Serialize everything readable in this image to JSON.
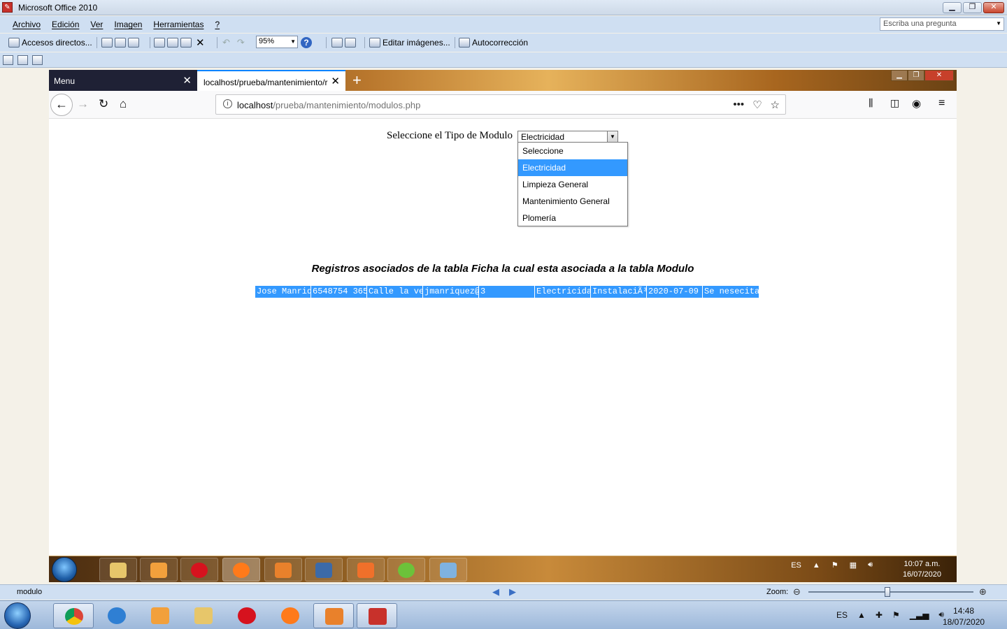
{
  "office": {
    "title": "Microsoft Office 2010",
    "menu": [
      "Archivo",
      "Edición",
      "Ver",
      "Imagen",
      "Herramientas",
      "?"
    ],
    "ask_placeholder": "Escriba una pregunta",
    "toolbar": {
      "shortcuts_label": "Accesos directos...",
      "zoom_value": "95%",
      "edit_images_label": "Editar imágenes...",
      "autocorrect_label": "Autocorrección"
    },
    "status": {
      "filename": "modulo",
      "zoom_label": "Zoom:",
      "zoom_level": 0.48
    }
  },
  "browser": {
    "tabs": [
      {
        "label": "Menu"
      },
      {
        "label": "localhost/prueba/mantenimiento/r"
      }
    ],
    "new_tab": "+",
    "url_host": "localhost",
    "url_path": "/prueba/mantenimiento/modulos.php",
    "page": {
      "select_label": "Seleccione el Tipo de Modulo",
      "selected_value": "Electricidad",
      "options": [
        "Seleccione",
        "Electricidad",
        "Limpieza General",
        "Mantenimiento General",
        "Plomería"
      ],
      "selected_index": 1,
      "heading": "Registros asociados de la tabla Ficha la cual esta asociada a la tabla Modulo",
      "row": [
        "Jose Manriq",
        "6548754 365",
        "Calle la ve",
        "jmanriquez@",
        "3",
        "Electricida",
        "InstalaciÃ³",
        "2020-07-09",
        "Se nesecita"
      ]
    },
    "inner_taskbar": {
      "lang": "ES",
      "time": "10:07 a.m.",
      "date": "16/07/2020"
    }
  },
  "taskbar": {
    "lang": "ES",
    "time": "14:48",
    "date": "18/07/2020"
  },
  "colors": {
    "selection": "#3399ff",
    "office_chrome": "#cfdff2"
  }
}
